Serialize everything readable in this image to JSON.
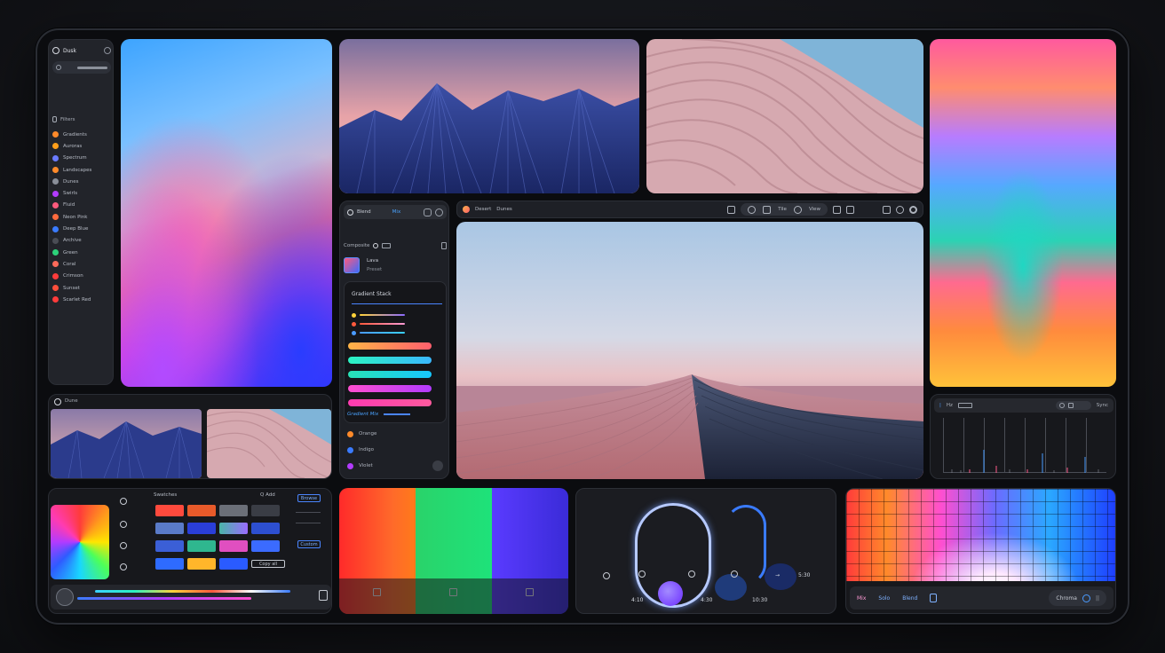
{
  "sidebar": {
    "title": "Dusk",
    "section_label": "Filters",
    "items": [
      {
        "label": "Gradients",
        "color": "#ff8a2a"
      },
      {
        "label": "Auroras",
        "color": "#ff9f1a"
      },
      {
        "label": "Spectrum",
        "color": "#6a7bff"
      },
      {
        "label": "Landscapes",
        "color": "#ff8a2a"
      },
      {
        "label": "Dunes",
        "color": "#8a8f99"
      },
      {
        "label": "Swirls",
        "color": "#b23bff"
      },
      {
        "label": "Fluid",
        "color": "#ff5a7d"
      },
      {
        "label": "Neon Pink",
        "color": "#ff6a3d"
      },
      {
        "label": "Deep Blue",
        "color": "#3a7bff"
      },
      {
        "label": "Archive",
        "color": "#4a4d55"
      },
      {
        "label": "Green",
        "color": "#2cd27a"
      },
      {
        "label": "Coral",
        "color": "#ff6a5a"
      },
      {
        "label": "Crimson",
        "color": "#ff3b3b"
      },
      {
        "label": "Sunset",
        "color": "#ff4f3b"
      },
      {
        "label": "Scarlet Red",
        "color": "#ff3b3b"
      }
    ]
  },
  "mini_panel": {
    "label": "Dune"
  },
  "layers": {
    "header_label": "Blend",
    "header_tab": "Mix",
    "row_label": "Composite",
    "asset_name": "Lava",
    "asset_sub": "Preset",
    "card_title": "Gradient Stack",
    "link_label": "Gradient Mix",
    "footer_items": [
      {
        "label": "Orange",
        "color": "#ff8a2a"
      },
      {
        "label": "Indigo",
        "color": "#3a7bff"
      },
      {
        "label": "Violet",
        "color": "#b23bff"
      }
    ]
  },
  "toolbar": {
    "left_label": "Desert",
    "second_label": "Dunes",
    "pill_label": "Tile",
    "view_label": "View"
  },
  "palette": {
    "label": "Swatches",
    "add_label": "Q Add",
    "btn1": "Browse",
    "btn2": "Custom",
    "copy_btn": "Copy all"
  },
  "player": {
    "time1": "4:10",
    "time2": "4:30",
    "time3": "10:30",
    "right_label": "5:30"
  },
  "spectrum": {
    "m1": "Mix",
    "m2": "Solo",
    "m3": "Blend",
    "pill_label": "Chroma"
  },
  "scope": {
    "label1": "Hz",
    "label2": "Sync"
  }
}
